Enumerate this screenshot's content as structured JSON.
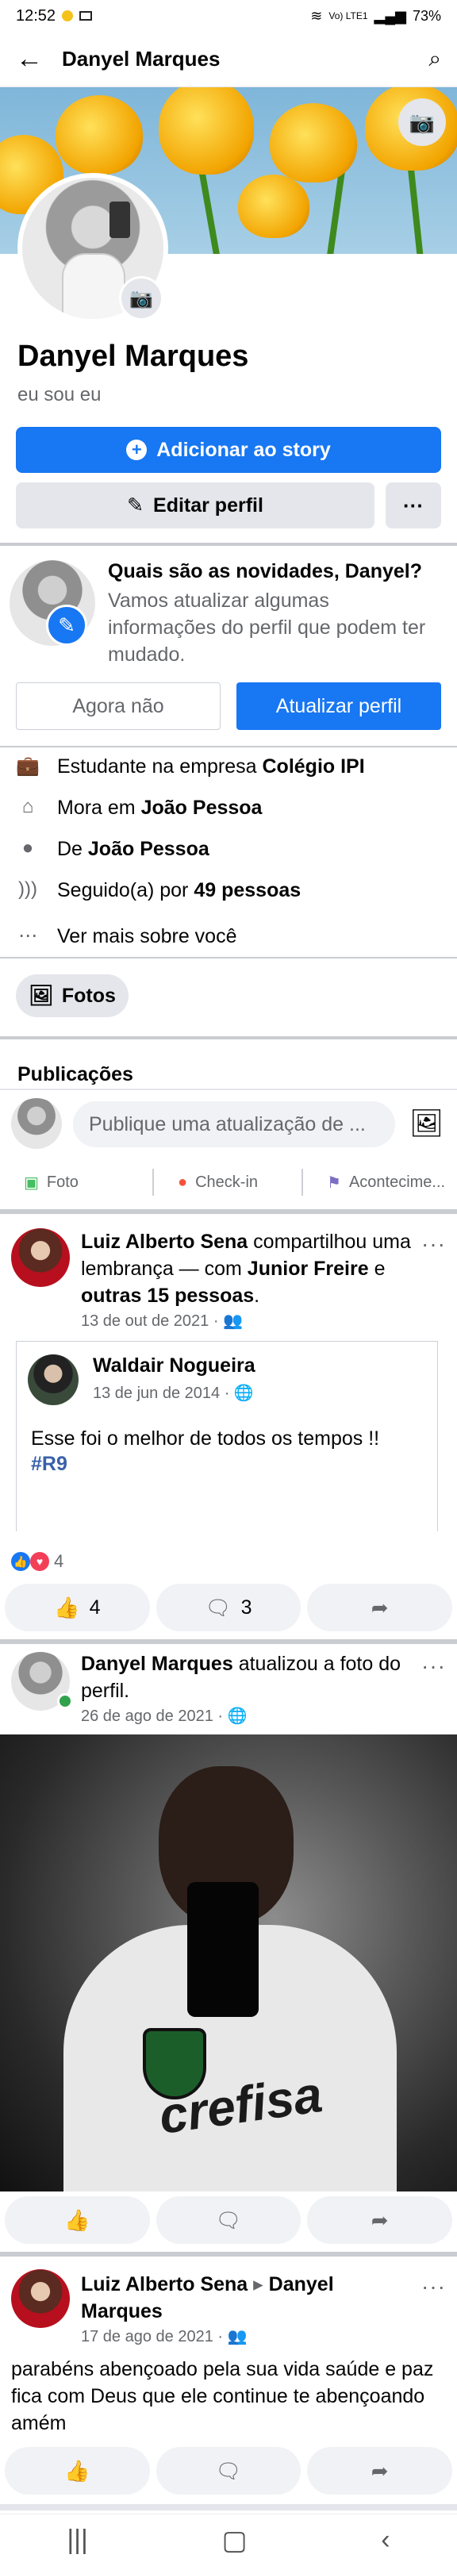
{
  "status": {
    "time": "12:52",
    "signal": "Vo) LTE1",
    "battery": "73%"
  },
  "topbar": {
    "title": "Danyel Marques"
  },
  "profile": {
    "name": "Danyel Marques",
    "bio": "eu sou eu"
  },
  "buttons": {
    "story": "Adicionar ao story",
    "edit": "Editar perfil",
    "more": "···"
  },
  "update_prompt": {
    "title": "Quais são as novidades, Danyel?",
    "text": "Vamos atualizar algumas informações do perfil que podem ter mudado.",
    "dismiss": "Agora não",
    "confirm": "Atualizar perfil"
  },
  "about": {
    "work_prefix": "Estudante na empresa ",
    "work_place": "Colégio IPI",
    "lives_prefix": "Mora em ",
    "lives_place": "João Pessoa",
    "from_prefix": "De ",
    "from_place": "João Pessoa",
    "followers_prefix": "Seguido(a) por ",
    "followers_count": "49 pessoas",
    "see_more": "Ver mais sobre você"
  },
  "photos_button": "Fotos",
  "publications": {
    "title": "Publicações",
    "composer_placeholder": "Publique uma atualização de ...",
    "actions": [
      "Foto",
      "Check-in",
      "Acontecime..."
    ]
  },
  "post1": {
    "author": "Luiz Alberto Sena",
    "action": " compartilhou uma lembrança — com ",
    "tag1": "Junior Freire",
    "and": " e ",
    "tag2": "outras 15 pessoas",
    "end": ".",
    "date": "13 de out de 2021 · ",
    "shared": {
      "author": "Waldair Nogueira",
      "date": "13 de jun de 2014 · ",
      "text": "Esse foi o melhor de todos os tempos !!",
      "hashtag": "#R9"
    },
    "reactions": "4",
    "likes": "4",
    "comments": "3"
  },
  "post2": {
    "author": "Danyel Marques",
    "action": " atualizou a foto do perfil.",
    "date": "26 de ago de 2021 · ",
    "shirt_text": "crefisa"
  },
  "post3": {
    "author": "Luiz Alberto Sena",
    "arrow": " ▸ ",
    "target": "Danyel Marques",
    "date": "17 de ago de 2021 · ",
    "text": "parabéns abençoado pela sua vida saúde e paz fica com Deus que ele continue te abençoando amém"
  },
  "colors": {
    "brand": "#1877f2",
    "bg_button": "#e4e6eb",
    "muted": "#65676b"
  }
}
